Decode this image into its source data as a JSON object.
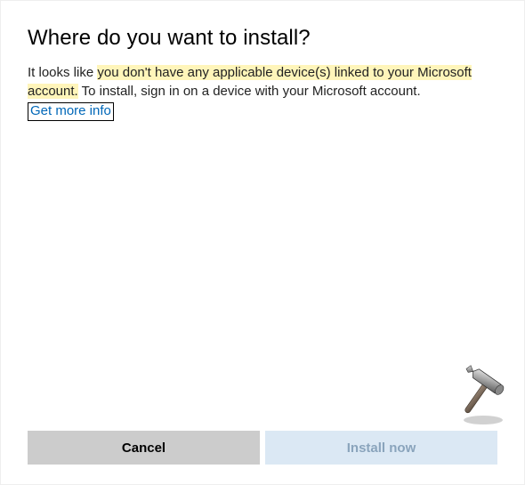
{
  "dialog": {
    "title": "Where do you want to install?",
    "message": {
      "prefix": "It looks like ",
      "highlighted": "you don't have any applicable device(s) linked to your Microsoft account.",
      "suffix": " To install, sign in on a device with your Microsoft account."
    },
    "link_label": "Get more info"
  },
  "buttons": {
    "cancel": "Cancel",
    "install": "Install now"
  },
  "colors": {
    "highlight_bg": "#fff5ba",
    "link_color": "#0067b8",
    "cancel_bg": "#cccccc",
    "install_bg": "#dbe8f4",
    "install_fg": "#8aa4bc"
  },
  "decorative": {
    "hammer_icon": "hammer-icon"
  }
}
